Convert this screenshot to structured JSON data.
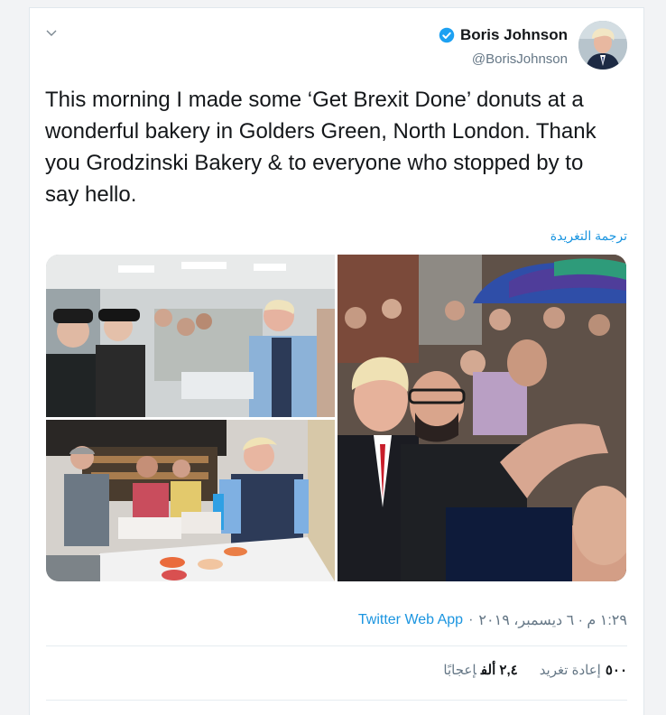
{
  "tweet": {
    "author_name": "Boris Johnson",
    "handle": "@BorisJohnson",
    "text": "This morning I made some ‘Get Brexit Done’ donuts at a wonderful bakery in Golders Green, North London. Thank you Grodzinski Bakery & to everyone who stopped by to say hello.",
    "translate_label": "ترجمة التغريدة",
    "timestamp": "١:٢٩ م · ٦ ديسمبر، ٢٠١٩",
    "app_separator": "·",
    "app": "Twitter Web App"
  },
  "stats": {
    "retweets_value": "٥٠٠",
    "retweets_label": "إعادة تغريد",
    "likes_value": "٢,٤ ألف",
    "likes_label": "إعجابًا"
  },
  "icons": {
    "menu": "chevron-down-icon",
    "verified": "verified-badge-icon"
  },
  "colors": {
    "link": "#1b95e0",
    "verified": "#1da1f2",
    "secondary_text": "#657786"
  }
}
